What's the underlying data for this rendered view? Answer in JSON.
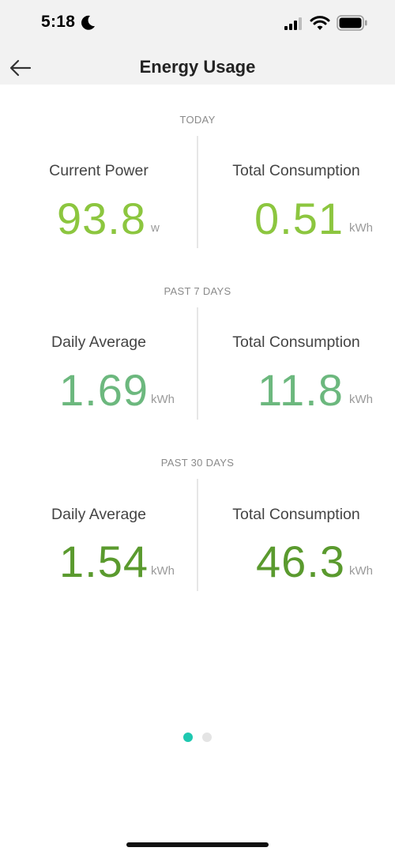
{
  "status_bar": {
    "time": "5:18"
  },
  "header": {
    "title": "Energy Usage"
  },
  "sections": [
    {
      "label": "TODAY",
      "left": {
        "title": "Current Power",
        "value": "93.8",
        "unit": "w"
      },
      "right": {
        "title": "Total Consumption",
        "value": "0.51",
        "unit": "kWh"
      }
    },
    {
      "label": "PAST 7 DAYS",
      "left": {
        "title": "Daily Average",
        "value": "1.69",
        "unit": "kWh"
      },
      "right": {
        "title": "Total Consumption",
        "value": "11.8",
        "unit": "kWh"
      }
    },
    {
      "label": "PAST 30 DAYS",
      "left": {
        "title": "Daily Average",
        "value": "1.54",
        "unit": "kWh"
      },
      "right": {
        "title": "Total Consumption",
        "value": "46.3",
        "unit": "kWh"
      }
    }
  ],
  "colors": {
    "today": "#8cc63f",
    "past_7_days": "#6cb87e",
    "past_30_days": "#5a9a2e",
    "active_dot": "#1ec8b0",
    "inactive_dot": "#e4e4e4"
  },
  "pagination": {
    "page_count": 2,
    "active_index": 0
  }
}
